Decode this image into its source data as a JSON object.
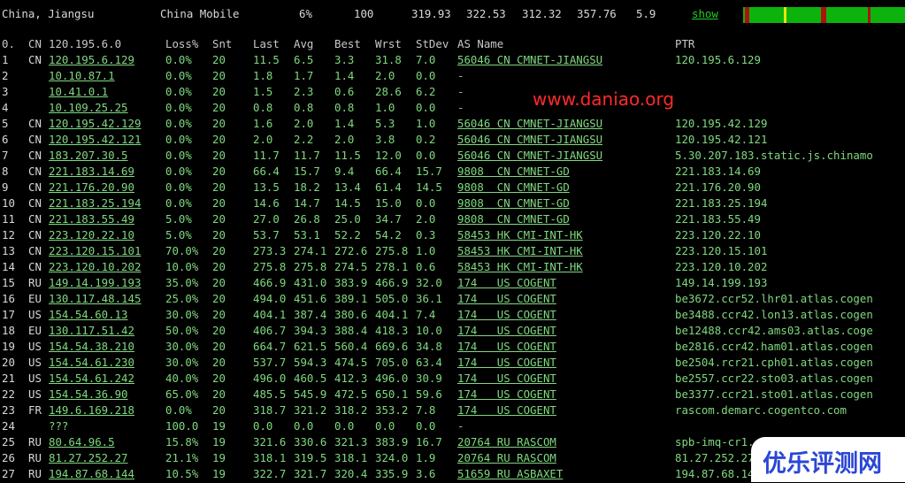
{
  "topbar": {
    "location": "China, Jiangsu",
    "isp": "China Mobile",
    "loss": "6%",
    "snt": "100",
    "last": "319.93",
    "avg": "322.53",
    "best": "312.32",
    "wrst": "357.76",
    "stdev": "5.9",
    "show": "show"
  },
  "colors": {
    "text": "#7fd97f",
    "header": "#c8c8c8",
    "watermark": "#ff2a2a",
    "badge_text": "#2b47d6",
    "bar_green": "#0db30d",
    "bar_red": "#b01010",
    "bar_yellow": "#e8e800"
  },
  "headers": {
    "idx": "0.",
    "cc": "CN",
    "host": "120.195.6.0",
    "loss": "Loss%",
    "snt": "Snt",
    "last": "Last",
    "avg": "Avg",
    "best": "Best",
    "wrst": "Wrst",
    "stdev": "StDev",
    "as": "AS Name",
    "ptr": "PTR"
  },
  "rows": [
    {
      "idx": "1",
      "cc": "CN",
      "host": "120.195.6.129",
      "loss": "0.0%",
      "snt": "20",
      "last": "11.5",
      "avg": "6.5",
      "best": "3.3",
      "wrst": "31.8",
      "stdev": "7.0",
      "as": "56046 CN CMNET-JIANGSU",
      "ptr": "120.195.6.129"
    },
    {
      "idx": "2",
      "cc": "",
      "host": "10.10.87.1",
      "loss": "0.0%",
      "snt": "20",
      "last": "1.8",
      "avg": "1.7",
      "best": "1.4",
      "wrst": "2.0",
      "stdev": "0.0",
      "as": "-",
      "ptr": ""
    },
    {
      "idx": "3",
      "cc": "",
      "host": "10.41.0.1",
      "loss": "0.0%",
      "snt": "20",
      "last": "1.5",
      "avg": "2.3",
      "best": "0.6",
      "wrst": "28.6",
      "stdev": "6.2",
      "as": "-",
      "ptr": ""
    },
    {
      "idx": "4",
      "cc": "",
      "host": "10.109.25.25",
      "loss": "0.0%",
      "snt": "20",
      "last": "0.8",
      "avg": "0.8",
      "best": "0.8",
      "wrst": "1.0",
      "stdev": "0.0",
      "as": "-",
      "ptr": ""
    },
    {
      "idx": "5",
      "cc": "CN",
      "host": "120.195.42.129",
      "loss": "0.0%",
      "snt": "20",
      "last": "1.6",
      "avg": "2.0",
      "best": "1.4",
      "wrst": "5.3",
      "stdev": "1.0",
      "as": "56046 CN CMNET-JIANGSU",
      "ptr": "120.195.42.129"
    },
    {
      "idx": "6",
      "cc": "CN",
      "host": "120.195.42.121",
      "loss": "0.0%",
      "snt": "20",
      "last": "2.0",
      "avg": "2.2",
      "best": "2.0",
      "wrst": "3.8",
      "stdev": "0.2",
      "as": "56046 CN CMNET-JIANGSU",
      "ptr": "120.195.42.121"
    },
    {
      "idx": "7",
      "cc": "CN",
      "host": "183.207.30.5",
      "loss": "0.0%",
      "snt": "20",
      "last": "11.7",
      "avg": "11.7",
      "best": "11.5",
      "wrst": "12.0",
      "stdev": "0.0",
      "as": "56046 CN CMNET-JIANGSU",
      "ptr": "5.30.207.183.static.js.chinamo"
    },
    {
      "idx": "8",
      "cc": "CN",
      "host": "221.183.14.69",
      "loss": "0.0%",
      "snt": "20",
      "last": "66.4",
      "avg": "15.7",
      "best": "9.4",
      "wrst": "66.4",
      "stdev": "15.7",
      "as": "9808  CN CMNET-GD",
      "ptr": "221.183.14.69"
    },
    {
      "idx": "9",
      "cc": "CN",
      "host": "221.176.20.90",
      "loss": "0.0%",
      "snt": "20",
      "last": "13.5",
      "avg": "18.2",
      "best": "13.4",
      "wrst": "61.4",
      "stdev": "14.5",
      "as": "9808  CN CMNET-GD",
      "ptr": "221.176.20.90"
    },
    {
      "idx": "10",
      "cc": "CN",
      "host": "221.183.25.194",
      "loss": "0.0%",
      "snt": "20",
      "last": "14.6",
      "avg": "14.7",
      "best": "14.5",
      "wrst": "15.0",
      "stdev": "0.0",
      "as": "9808  CN CMNET-GD",
      "ptr": "221.183.25.194"
    },
    {
      "idx": "11",
      "cc": "CN",
      "host": "221.183.55.49",
      "loss": "5.0%",
      "snt": "20",
      "last": "27.0",
      "avg": "26.8",
      "best": "25.0",
      "wrst": "34.7",
      "stdev": "2.0",
      "as": "9808  CN CMNET-GD",
      "ptr": "221.183.55.49"
    },
    {
      "idx": "12",
      "cc": "CN",
      "host": "223.120.22.10",
      "loss": "5.0%",
      "snt": "20",
      "last": "53.7",
      "avg": "53.1",
      "best": "52.2",
      "wrst": "54.2",
      "stdev": "0.3",
      "as": "58453 HK CMI-INT-HK",
      "ptr": "223.120.22.10"
    },
    {
      "idx": "13",
      "cc": "CN",
      "host": "223.120.15.101",
      "loss": "70.0%",
      "snt": "20",
      "last": "273.3",
      "avg": "274.1",
      "best": "272.6",
      "wrst": "275.8",
      "stdev": "1.0",
      "as": "58453 HK CMI-INT-HK",
      "ptr": "223.120.15.101"
    },
    {
      "idx": "14",
      "cc": "CN",
      "host": "223.120.10.202",
      "loss": "10.0%",
      "snt": "20",
      "last": "275.8",
      "avg": "275.8",
      "best": "274.5",
      "wrst": "278.1",
      "stdev": "0.6",
      "as": "58453 HK CMI-INT-HK",
      "ptr": "223.120.10.202"
    },
    {
      "idx": "15",
      "cc": "RU",
      "host": "149.14.199.193",
      "loss": "35.0%",
      "snt": "20",
      "last": "466.9",
      "avg": "431.0",
      "best": "383.9",
      "wrst": "466.9",
      "stdev": "32.0",
      "as": "174   US COGENT",
      "ptr": "149.14.199.193"
    },
    {
      "idx": "16",
      "cc": "EU",
      "host": "130.117.48.145",
      "loss": "25.0%",
      "snt": "20",
      "last": "494.0",
      "avg": "451.6",
      "best": "389.1",
      "wrst": "505.0",
      "stdev": "36.1",
      "as": "174   US COGENT",
      "ptr": "be3672.ccr52.lhr01.atlas.cogen"
    },
    {
      "idx": "17",
      "cc": "US",
      "host": "154.54.60.13",
      "loss": "30.0%",
      "snt": "20",
      "last": "404.1",
      "avg": "387.4",
      "best": "380.6",
      "wrst": "404.1",
      "stdev": "7.4",
      "as": "174   US COGENT",
      "ptr": "be3488.ccr42.lon13.atlas.cogen"
    },
    {
      "idx": "18",
      "cc": "EU",
      "host": "130.117.51.42",
      "loss": "50.0%",
      "snt": "20",
      "last": "406.7",
      "avg": "394.3",
      "best": "388.4",
      "wrst": "418.3",
      "stdev": "10.0",
      "as": "174   US COGENT",
      "ptr": "be12488.ccr42.ams03.atlas.coge"
    },
    {
      "idx": "19",
      "cc": "US",
      "host": "154.54.38.210",
      "loss": "30.0%",
      "snt": "20",
      "last": "664.7",
      "avg": "621.5",
      "best": "560.4",
      "wrst": "669.6",
      "stdev": "34.8",
      "as": "174   US COGENT",
      "ptr": "be2816.ccr42.ham01.atlas.cogen"
    },
    {
      "idx": "20",
      "cc": "US",
      "host": "154.54.61.230",
      "loss": "30.0%",
      "snt": "20",
      "last": "537.7",
      "avg": "594.3",
      "best": "474.5",
      "wrst": "705.0",
      "stdev": "63.4",
      "as": "174   US COGENT",
      "ptr": "be2504.rcr21.cph01.atlas.cogen"
    },
    {
      "idx": "21",
      "cc": "US",
      "host": "154.54.61.242",
      "loss": "40.0%",
      "snt": "20",
      "last": "496.0",
      "avg": "460.5",
      "best": "412.3",
      "wrst": "496.0",
      "stdev": "30.9",
      "as": "174   US COGENT",
      "ptr": "be2557.ccr22.sto03.atlas.cogen"
    },
    {
      "idx": "22",
      "cc": "US",
      "host": "154.54.36.90",
      "loss": "65.0%",
      "snt": "20",
      "last": "485.5",
      "avg": "545.9",
      "best": "472.5",
      "wrst": "650.1",
      "stdev": "59.6",
      "as": "174   US COGENT",
      "ptr": "be3377.ccr21.sto01.atlas.cogen"
    },
    {
      "idx": "23",
      "cc": "FR",
      "host": "149.6.169.218",
      "loss": "0.0%",
      "snt": "20",
      "last": "318.7",
      "avg": "321.2",
      "best": "318.2",
      "wrst": "353.2",
      "stdev": "7.8",
      "as": "174   US COGENT",
      "ptr": "rascom.demarc.cogentco.com"
    },
    {
      "idx": "24",
      "cc": "",
      "host": "???",
      "loss": "100.0",
      "snt": "19",
      "last": "0.0",
      "avg": "0.0",
      "best": "0.0",
      "wrst": "0.0",
      "stdev": "0.0",
      "as": "-",
      "ptr": ""
    },
    {
      "idx": "25",
      "cc": "RU",
      "host": "80.64.96.5",
      "loss": "15.8%",
      "snt": "19",
      "last": "321.6",
      "avg": "330.6",
      "best": "321.3",
      "wrst": "383.9",
      "stdev": "16.7",
      "as": "20764 RU RASCOM",
      "ptr": "spb-imq-cr1."
    },
    {
      "idx": "26",
      "cc": "RU",
      "host": "81.27.252.27",
      "loss": "21.1%",
      "snt": "19",
      "last": "318.1",
      "avg": "319.5",
      "best": "318.1",
      "wrst": "324.0",
      "stdev": "1.9",
      "as": "20764 RU RASCOM",
      "ptr": "81.27.252.27"
    },
    {
      "idx": "27",
      "cc": "RU",
      "host": "194.87.68.144",
      "loss": "10.5%",
      "snt": "19",
      "last": "322.7",
      "avg": "321.7",
      "best": "320.4",
      "wrst": "335.9",
      "stdev": "3.6",
      "as": "51659 RU ASBAXET",
      "ptr": "194.87.68.14"
    }
  ],
  "watermark": "www.daniao.org",
  "badge": "优乐评测网"
}
